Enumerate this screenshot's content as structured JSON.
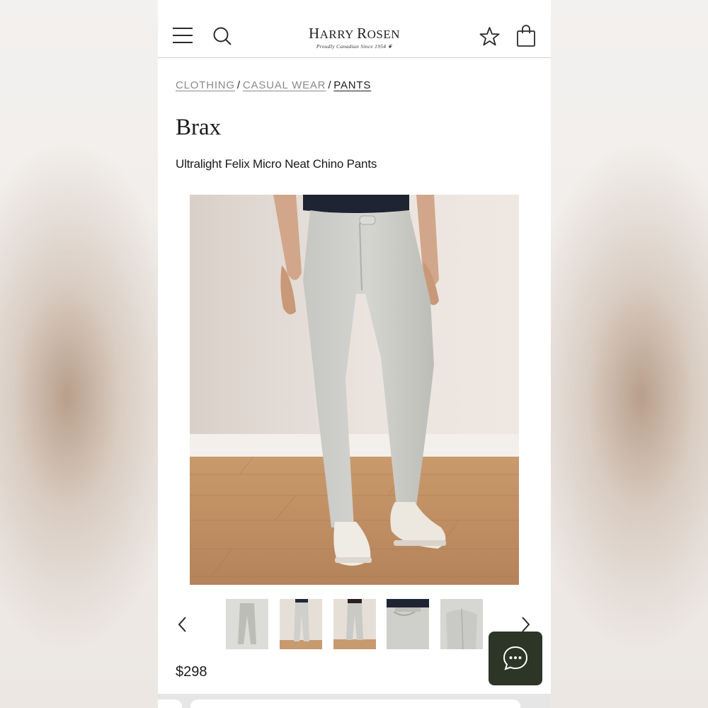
{
  "header": {
    "logo_name_first": "H",
    "logo_name_rest_1": "ARRY ",
    "logo_name_second": "R",
    "logo_name_rest_2": "OSEN",
    "logo_tagline": "Proudly Canadian Since 1954"
  },
  "breadcrumb": {
    "items": [
      {
        "label": "CLOTHING"
      },
      {
        "label": "CASUAL WEAR"
      },
      {
        "label": "PANTS"
      }
    ],
    "separator": "/"
  },
  "product": {
    "brand": "Brax",
    "name": "Ultralight Felix Micro Neat Chino Pants",
    "price": "$298",
    "gallery_count": 5
  },
  "icons": {
    "menu": "hamburger-menu-icon",
    "search": "search-icon",
    "wishlist": "star-icon",
    "cart": "shopping-bag-icon",
    "prev": "chevron-left-icon",
    "next": "chevron-right-icon",
    "chat": "chat-bubble-icon"
  },
  "colors": {
    "chat_button": "#2c3526",
    "page_background": "#ffffff",
    "text": "#1a1a1a",
    "breadcrumb_muted": "#8a8a8a"
  }
}
